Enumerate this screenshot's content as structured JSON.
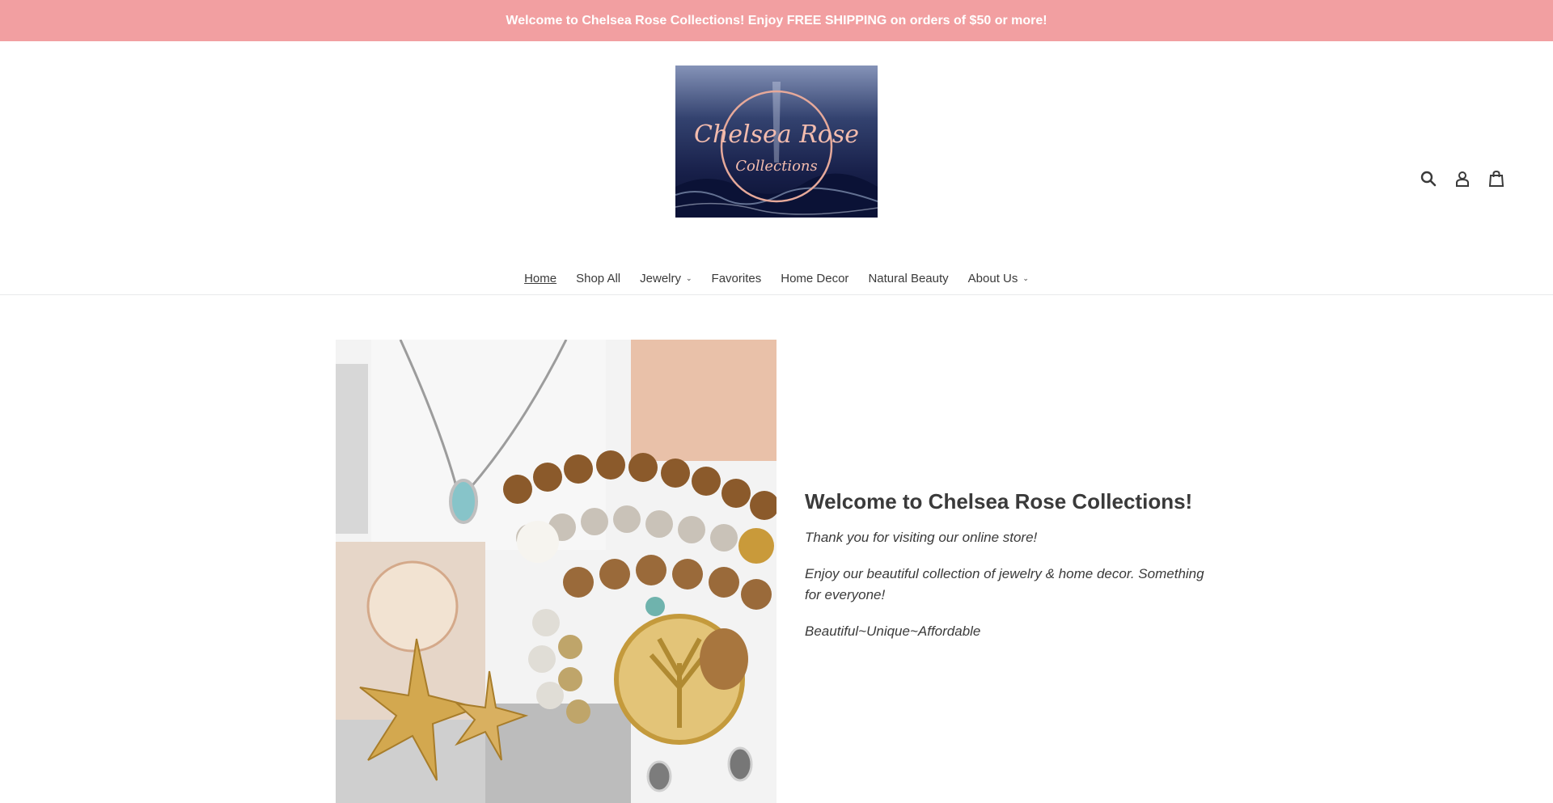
{
  "announcement": {
    "text": "Welcome to Chelsea Rose Collections! Enjoy FREE SHIPPING on orders of $50 or more!"
  },
  "header": {
    "logo": {
      "line1": "Chelsea Rose",
      "line2": "Collections"
    },
    "icons": [
      "search-icon",
      "account-icon",
      "cart-icon"
    ]
  },
  "nav": {
    "items": [
      {
        "label": "Home",
        "active": true,
        "dropdown": false
      },
      {
        "label": "Shop All",
        "active": false,
        "dropdown": false
      },
      {
        "label": "Jewelry",
        "active": false,
        "dropdown": true
      },
      {
        "label": "Favorites",
        "active": false,
        "dropdown": false
      },
      {
        "label": "Home Decor",
        "active": false,
        "dropdown": false
      },
      {
        "label": "Natural Beauty",
        "active": false,
        "dropdown": false
      },
      {
        "label": "About Us",
        "active": false,
        "dropdown": true
      }
    ]
  },
  "hero": {
    "title": "Welcome to Chelsea Rose Collections!",
    "paragraphs": [
      "Thank you for visiting our online store!",
      "Enjoy our beautiful collection of jewelry & home decor. Something for everyone!",
      "Beautiful~Unique~Affordable"
    ]
  },
  "colors": {
    "announcement_bg": "#f29fa1",
    "logo_text": "#f0b7a9",
    "text": "#3a3a3a"
  }
}
